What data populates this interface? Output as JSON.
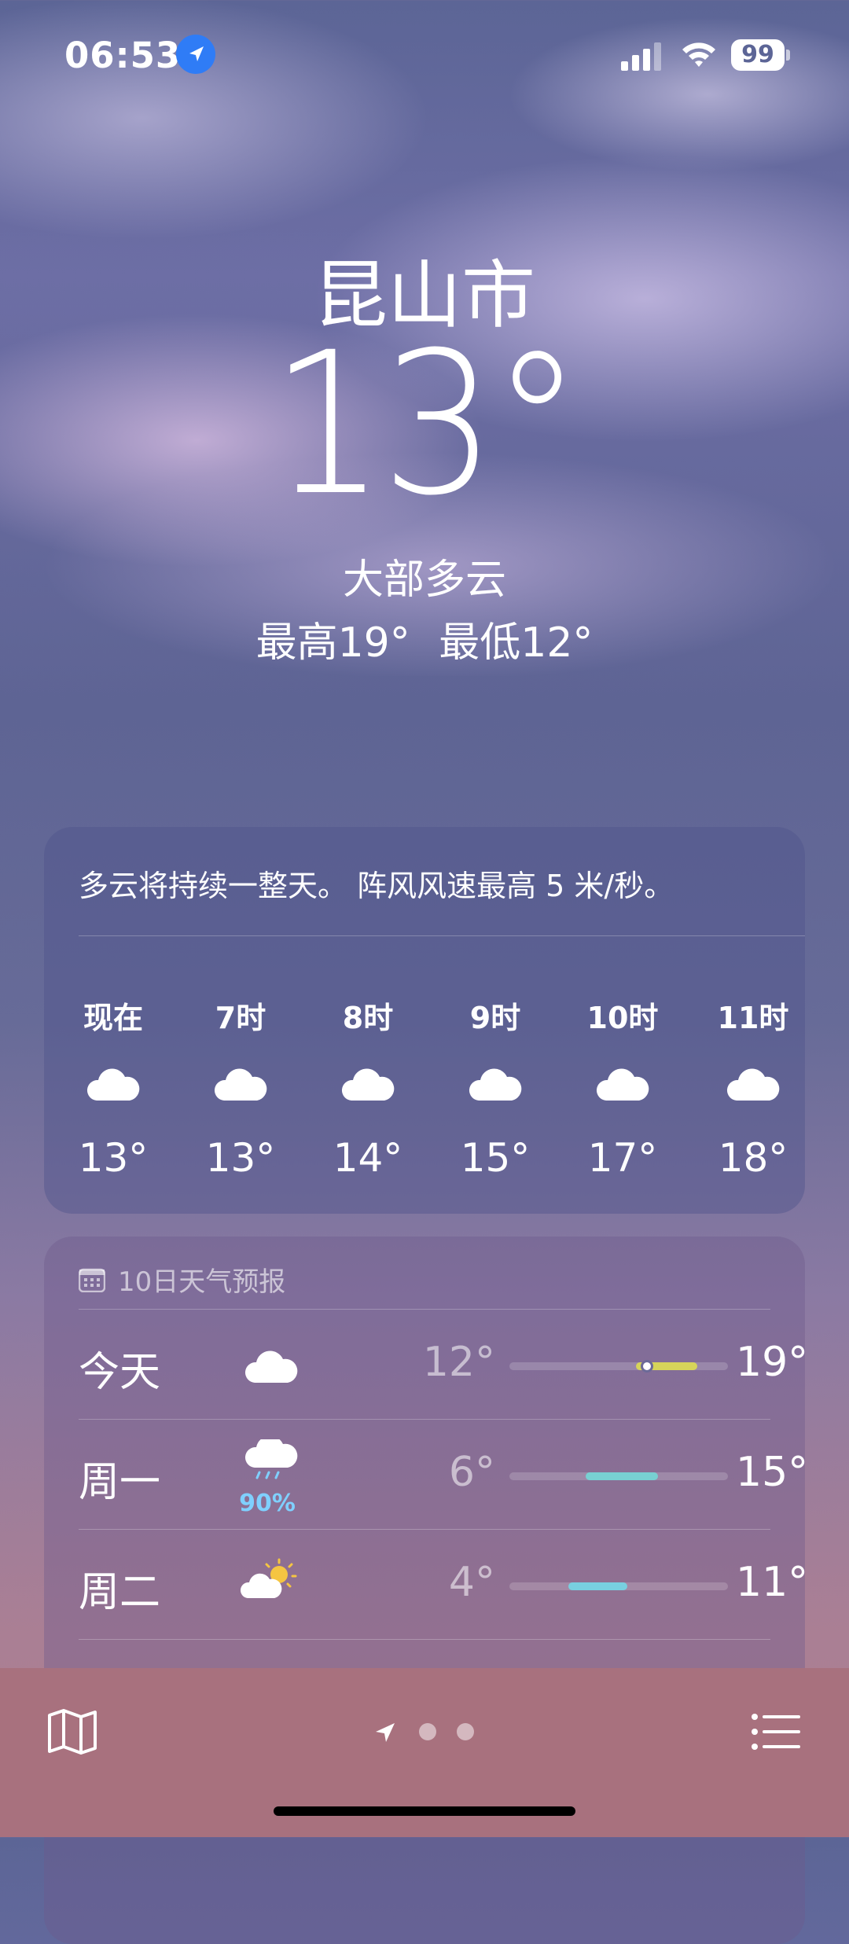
{
  "status_bar": {
    "time": "06:53",
    "battery": "99"
  },
  "location": {
    "city": "昆山市",
    "temperature": "13°",
    "condition": "大部多云",
    "high": "最高19°",
    "low": "最低12°"
  },
  "hourly": {
    "summary": "多云将持续一整天。 阵风风速最高 5 米/秒。",
    "items": [
      {
        "label": "现在",
        "icon": "cloud-icon",
        "temp": "13°"
      },
      {
        "label": "7时",
        "icon": "cloud-icon",
        "temp": "13°"
      },
      {
        "label": "8时",
        "icon": "cloud-icon",
        "temp": "14°"
      },
      {
        "label": "9时",
        "icon": "cloud-icon",
        "temp": "15°"
      },
      {
        "label": "10时",
        "icon": "cloud-icon",
        "temp": "17°"
      },
      {
        "label": "11时",
        "icon": "cloud-icon",
        "temp": "18°"
      }
    ]
  },
  "daily": {
    "header": "10日天气预报",
    "days": [
      {
        "day": "今天",
        "icon": "cloud-icon",
        "precip": "",
        "low": "12°",
        "high": "19°",
        "bar_start": 0.58,
        "bar_end": 0.86,
        "bar_color": "#d6d45a",
        "current_dot": 0.63
      },
      {
        "day": "周一",
        "icon": "rain-cloud-icon",
        "precip": "90%",
        "low": "6°",
        "high": "15°",
        "bar_start": 0.35,
        "bar_end": 0.68,
        "bar_color": "#78d0d2"
      },
      {
        "day": "周二",
        "icon": "partly-sunny-icon",
        "precip": "",
        "low": "4°",
        "high": "11°",
        "bar_start": 0.27,
        "bar_end": 0.54,
        "bar_color": "#78d0e0"
      }
    ]
  },
  "colors": {
    "card": "#5a5e92",
    "tabbar": "#a8717e",
    "location_blue": "#2f7cf6"
  }
}
